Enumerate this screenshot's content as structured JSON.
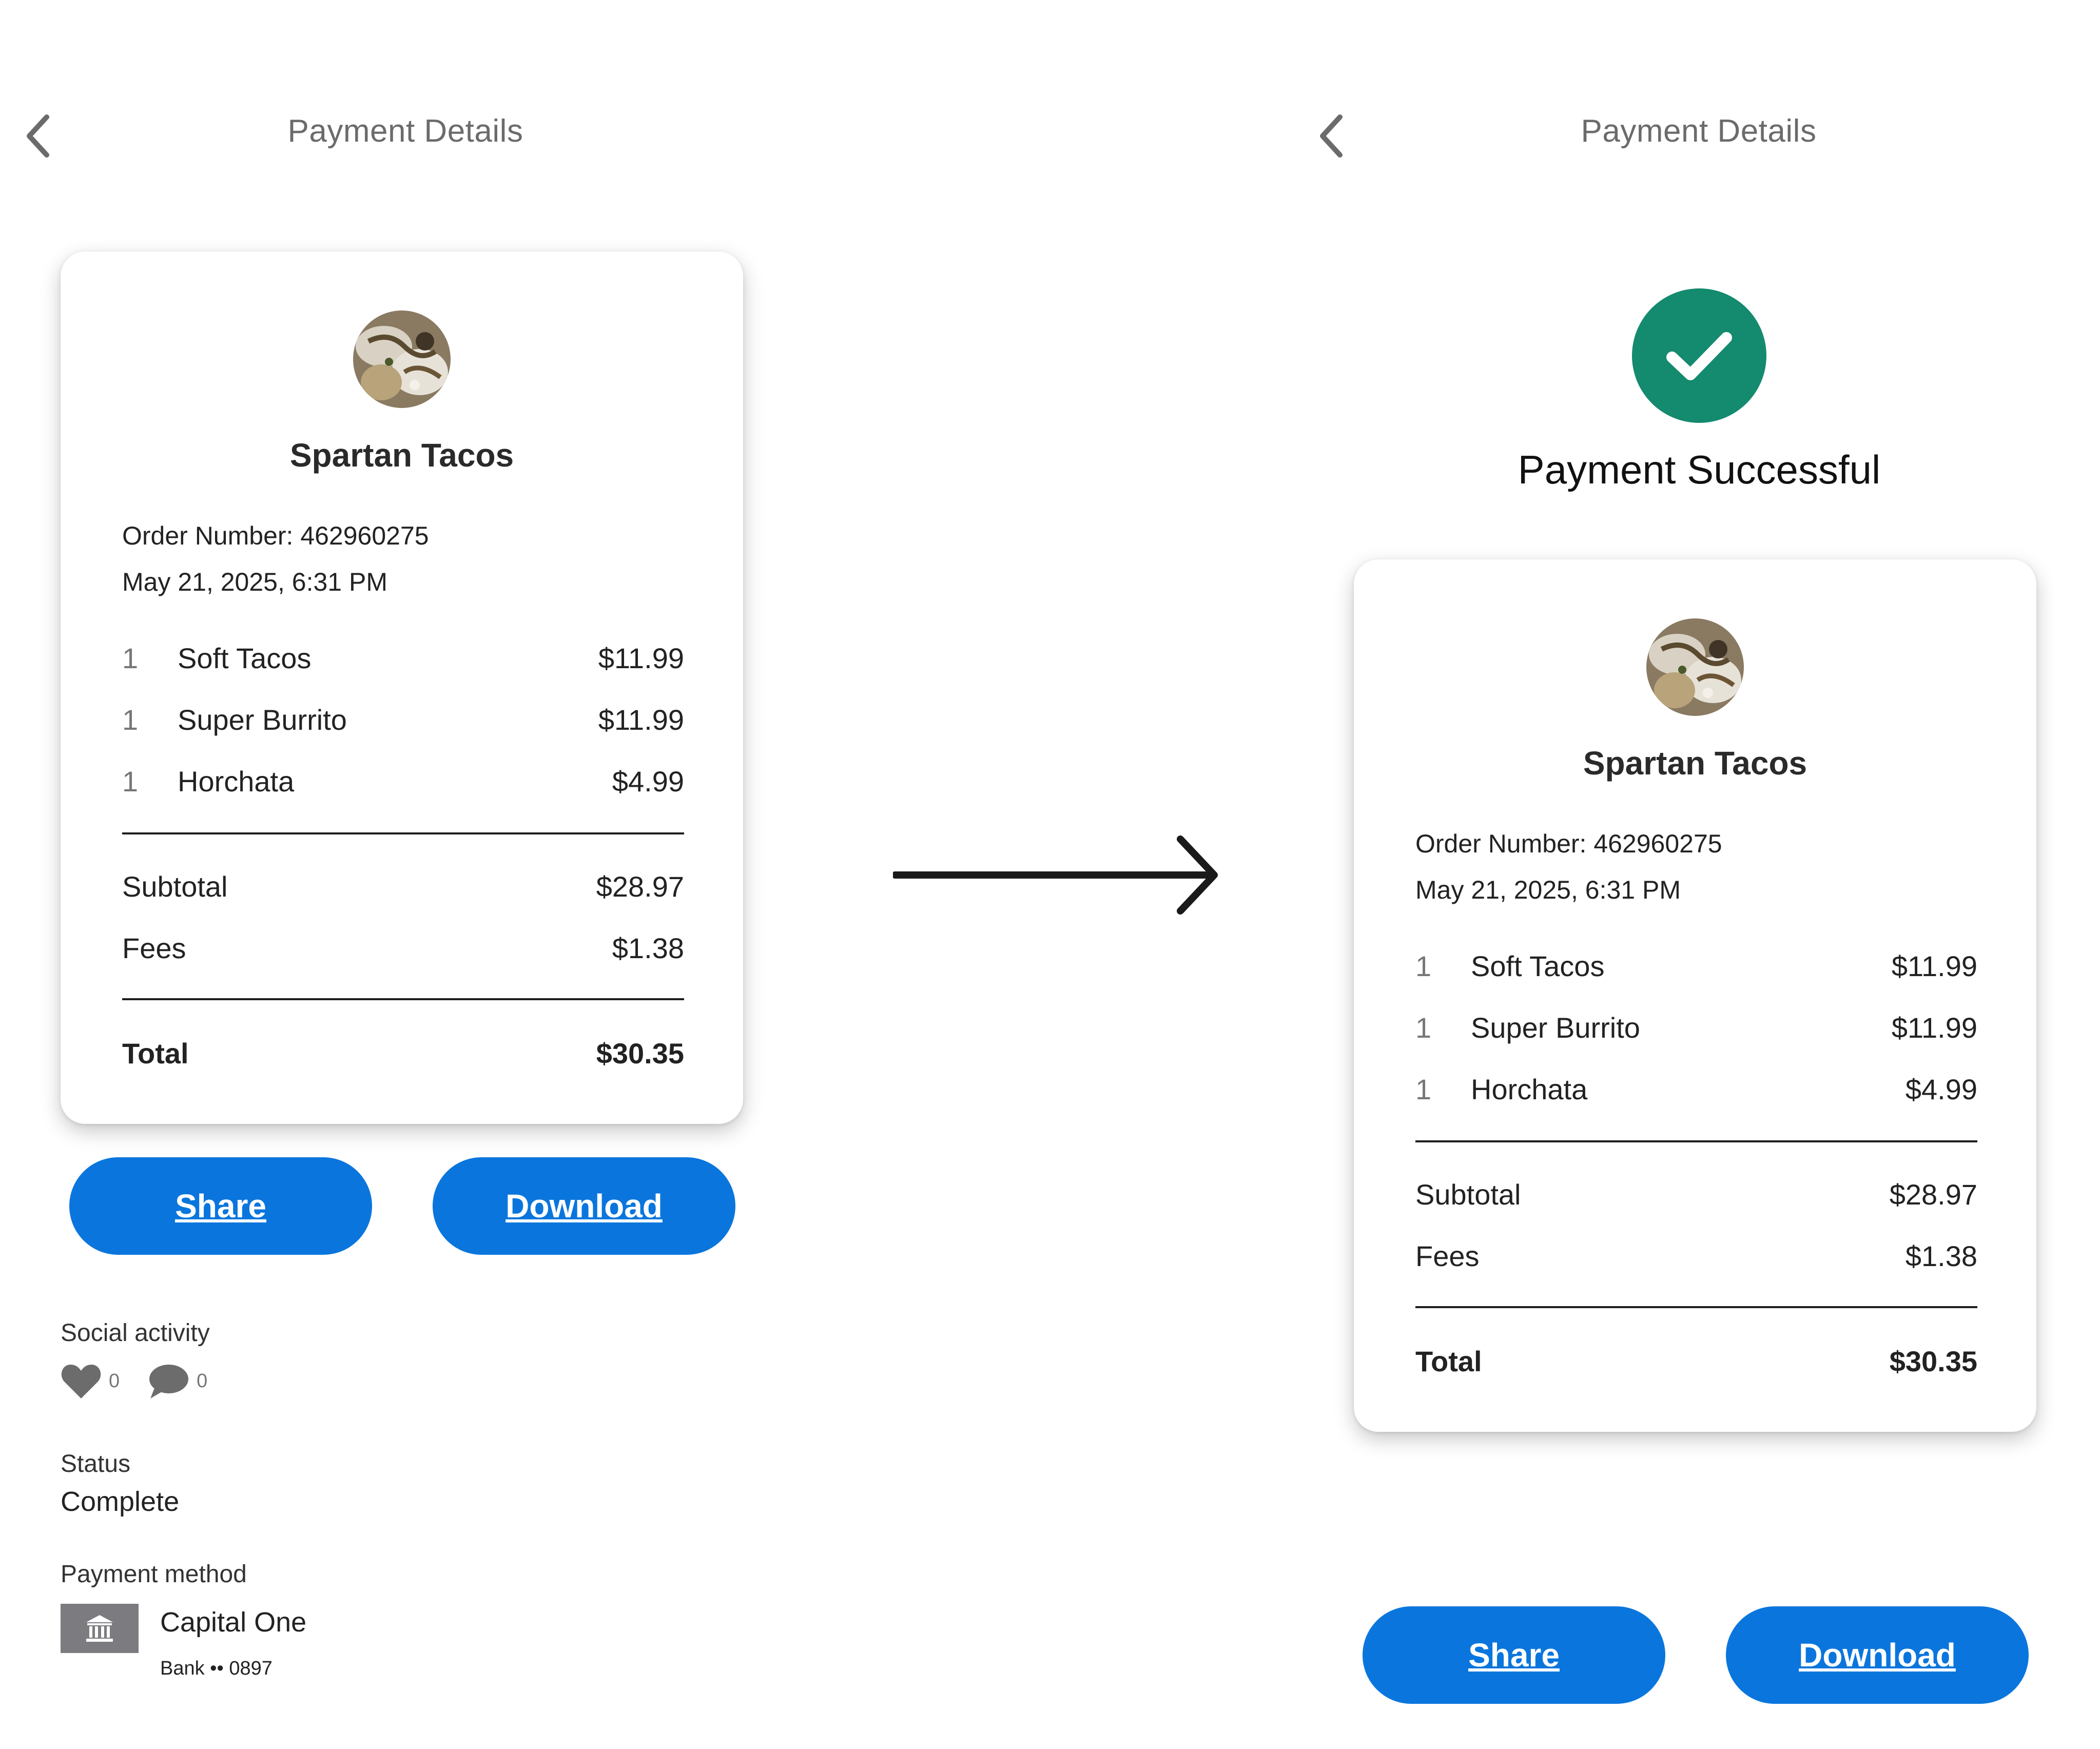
{
  "left_screen": {
    "nav_title": "Payment Details",
    "receipt": {
      "merchant": "Spartan Tacos",
      "order_number": "Order Number: 462960275",
      "date": "May 21, 2025, 6:31 PM",
      "items": [
        {
          "qty": "1",
          "name": "Soft Tacos",
          "price": "$11.99"
        },
        {
          "qty": "1",
          "name": "Super Burrito",
          "price": "$11.99"
        },
        {
          "qty": "1",
          "name": "Horchata",
          "price": "$4.99"
        }
      ],
      "subtotal_label": "Subtotal",
      "subtotal": "$28.97",
      "fees_label": "Fees",
      "fees": "$1.38",
      "total_label": "Total",
      "total": "$30.35"
    },
    "share_label": "Share",
    "download_label": "Download",
    "social_label": "Social activity",
    "likes": "0",
    "comments": "0",
    "status_label": "Status",
    "status_value": "Complete",
    "payment_method_label": "Payment method",
    "bank_name": "Capital One",
    "bank_detail": "Bank •• 0897"
  },
  "right_screen": {
    "nav_title": "Payment Details",
    "success_text": "Payment Successful",
    "receipt": {
      "merchant": "Spartan Tacos",
      "order_number": "Order Number: 462960275",
      "date": "May 21, 2025, 6:31 PM",
      "items": [
        {
          "qty": "1",
          "name": "Soft Tacos",
          "price": "$11.99"
        },
        {
          "qty": "1",
          "name": "Super Burrito",
          "price": "$11.99"
        },
        {
          "qty": "1",
          "name": "Horchata",
          "price": "$4.99"
        }
      ],
      "subtotal_label": "Subtotal",
      "subtotal": "$28.97",
      "fees_label": "Fees",
      "fees": "$1.38",
      "total_label": "Total",
      "total": "$30.35"
    },
    "share_label": "Share",
    "download_label": "Download"
  },
  "icons": {
    "back": "chevron-left-icon",
    "success": "check-circle-icon",
    "like": "heart-icon",
    "comment": "speech-bubble-icon",
    "bank": "bank-icon",
    "transition": "arrow-right-icon"
  },
  "colors": {
    "primary_button": "#0a76dd",
    "success_green": "#148a6e",
    "bank_icon_bg": "#7b7b80"
  }
}
